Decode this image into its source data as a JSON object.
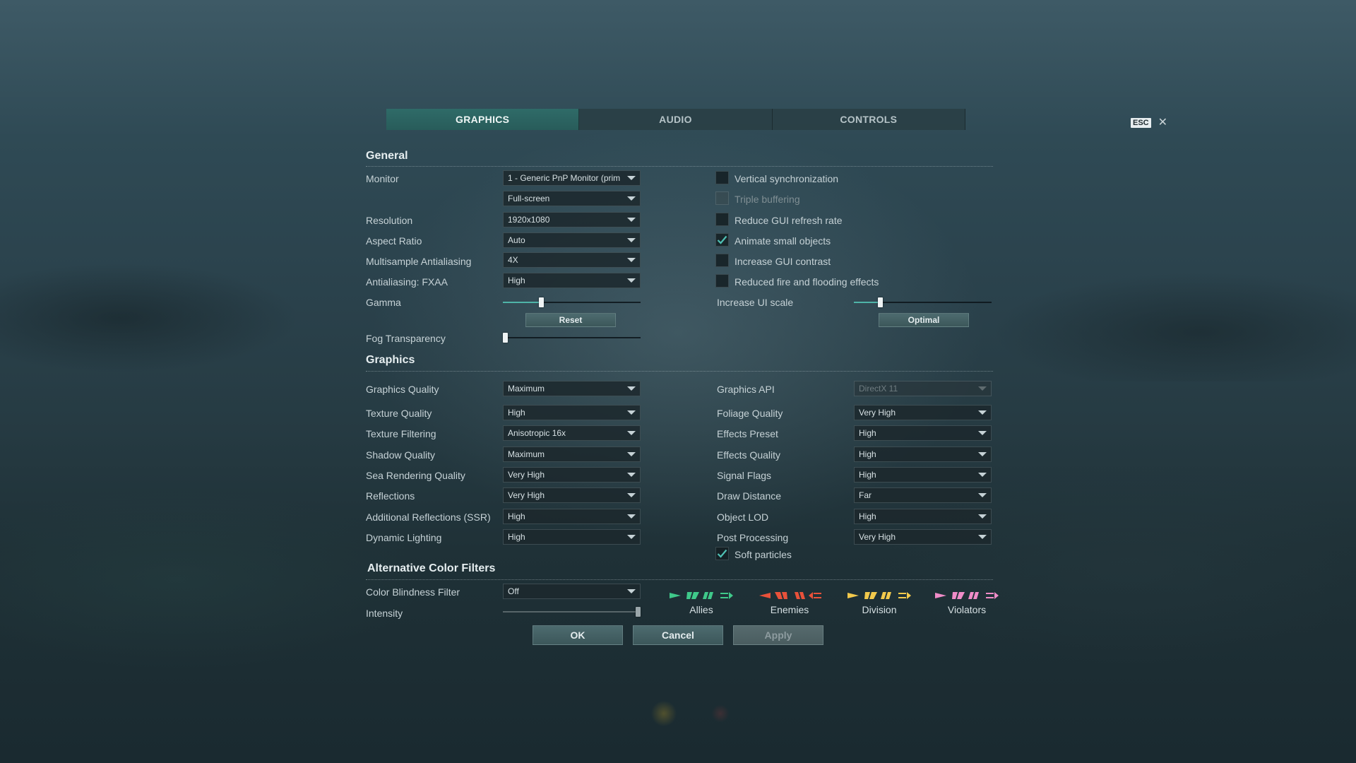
{
  "tabs": [
    "GRAPHICS",
    "AUDIO",
    "CONTROLS"
  ],
  "esc": {
    "key": "ESC",
    "close": "✕"
  },
  "general": {
    "title": "General",
    "monitor_label": "Monitor",
    "monitor_value": "1 - Generic PnP Monitor (prim",
    "mode_value": "Full-screen",
    "resolution_label": "Resolution",
    "resolution_value": "1920x1080",
    "aspect_label": "Aspect Ratio",
    "aspect_value": "Auto",
    "msaa_label": "Multisample Antialiasing",
    "msaa_value": "4X",
    "fxaa_label": "Antialiasing: FXAA",
    "fxaa_value": "High",
    "gamma_label": "Gamma",
    "gamma_level": 0.27,
    "reset_label": "Reset",
    "fog_label": "Fog Transparency",
    "fog_level": 0.0,
    "vsync_label": "Vertical synchronization",
    "vsync_checked": false,
    "triple_label": "Triple buffering",
    "triple_checked": false,
    "reduce_gui_label": "Reduce GUI refresh rate",
    "reduce_gui_checked": false,
    "animate_label": "Animate small objects",
    "animate_checked": true,
    "contrast_label": "Increase GUI contrast",
    "contrast_checked": false,
    "fire_label": "Reduced fire and flooding effects",
    "fire_checked": false,
    "ui_scale_label": "Increase UI scale",
    "ui_scale_level": 0.18,
    "optimal_label": "Optimal"
  },
  "graphics": {
    "title": "Graphics",
    "left": [
      {
        "label": "Graphics Quality",
        "value": "Maximum"
      },
      {
        "label": "Texture Quality",
        "value": "High"
      },
      {
        "label": "Texture Filtering",
        "value": "Anisotropic 16x"
      },
      {
        "label": "Shadow Quality",
        "value": "Maximum"
      },
      {
        "label": "Sea Rendering Quality",
        "value": "Very High"
      },
      {
        "label": "Reflections",
        "value": "Very High"
      },
      {
        "label": "Additional Reflections (SSR)",
        "value": "High"
      },
      {
        "label": "Dynamic Lighting",
        "value": "High"
      }
    ],
    "right": [
      {
        "label": "Graphics API",
        "value": "DirectX 11"
      },
      {
        "label": "Foliage Quality",
        "value": "Very High"
      },
      {
        "label": "Effects Preset",
        "value": "High"
      },
      {
        "label": "Effects Quality",
        "value": "High"
      },
      {
        "label": "Signal Flags",
        "value": "High"
      },
      {
        "label": "Draw Distance",
        "value": "Far"
      },
      {
        "label": "Object LOD",
        "value": "High"
      },
      {
        "label": "Post Processing",
        "value": "Very High"
      }
    ],
    "soft_particles_label": "Soft particles",
    "soft_particles_checked": true
  },
  "filters": {
    "title": "Alternative Color Filters",
    "cb_label": "Color Blindness Filter",
    "cb_value": "Off",
    "intensity_label": "Intensity",
    "intensity_level": 1.0,
    "groups": [
      {
        "label": "Allies",
        "color": "#3fc98a"
      },
      {
        "label": "Enemies",
        "color": "#e8513a"
      },
      {
        "label": "Division",
        "color": "#f2c94c"
      },
      {
        "label": "Violators",
        "color": "#f08cc8"
      }
    ]
  },
  "buttons": {
    "ok": "OK",
    "cancel": "Cancel",
    "apply": "Apply"
  },
  "colors": {
    "accent": "#4fb4a8",
    "active_tab": "#2f6b68"
  }
}
